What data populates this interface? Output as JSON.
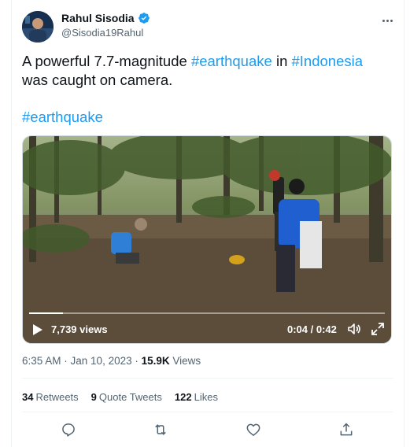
{
  "author": {
    "name": "Rahul Sisodia",
    "handle": "@Sisodia19Rahul",
    "verified": true
  },
  "tweet": {
    "text_start": "A powerful 7.7-magnitude ",
    "hashtag1": "#earthquake",
    "text_mid": " in ",
    "hashtag2": "#Indonesia",
    "text_end": " was caught on camera.",
    "hashtag3": "#earthquake"
  },
  "video": {
    "views": "7,739 views",
    "time": "0:04 / 0:42",
    "progress_fraction": 0.095
  },
  "meta": {
    "time": "6:35 AM",
    "separator": " · ",
    "date": "Jan 10, 2023",
    "views_count": "15.9K",
    "views_label": " Views"
  },
  "stats": {
    "retweets_count": "34",
    "retweets_label": "Retweets",
    "quotes_count": "9",
    "quotes_label": "Quote Tweets",
    "likes_count": "122",
    "likes_label": "Likes"
  },
  "icons": {
    "reply": "reply-icon",
    "retweet": "retweet-icon",
    "like": "like-icon",
    "share": "share-icon"
  },
  "colors": {
    "accent": "#1d9bf0",
    "text": "#0f1419",
    "secondary": "#536471"
  }
}
